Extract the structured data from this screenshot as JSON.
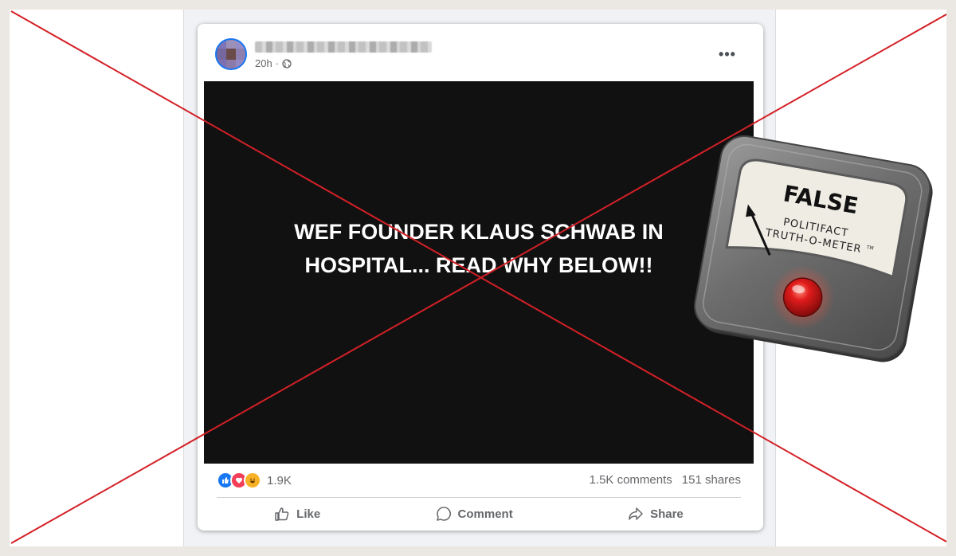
{
  "post": {
    "author_name": "Name hidden",
    "timestamp": "20h",
    "visibility_icon": "globe-icon",
    "more_icon": "more-options-icon",
    "media_text": "WEF FOUNDER KLAUS SCHWAB IN HOSPITAL... READ WHY BELOW!!",
    "reactions_count": "1.9K",
    "comments": "1.5K comments",
    "shares": "151 shares",
    "actions": {
      "like": "Like",
      "comment": "Comment",
      "share": "Share"
    }
  },
  "rating": {
    "verdict": "FALSE",
    "brand_line1": "POLITIFACT",
    "brand_line2": "TRUTH-O-METER",
    "trademark": "TM"
  },
  "colors": {
    "x_line": "#d42027",
    "facebook_blue": "#1877f2",
    "meter_red": "#e01b1b"
  }
}
